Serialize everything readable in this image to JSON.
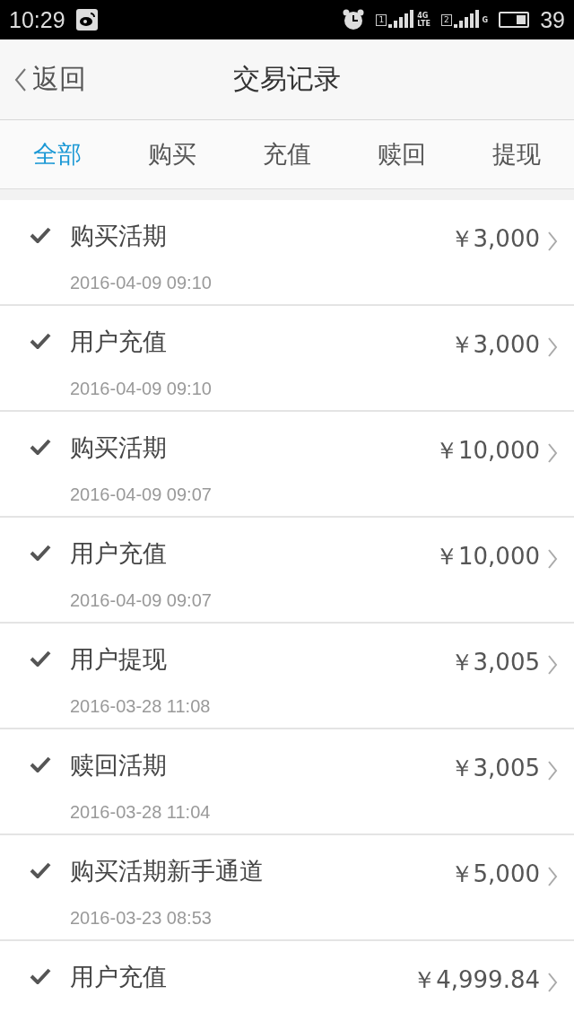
{
  "status_bar": {
    "time": "10:29",
    "sims": [
      {
        "slot": "1",
        "network": "4G",
        "sub": "LTE"
      },
      {
        "slot": "2",
        "network": "G"
      }
    ],
    "battery": "39"
  },
  "header": {
    "back": "返回",
    "title": "交易记录"
  },
  "tabs": [
    {
      "label": "全部",
      "selected": true
    },
    {
      "label": "购买",
      "selected": false
    },
    {
      "label": "充值",
      "selected": false
    },
    {
      "label": "赎回",
      "selected": false
    },
    {
      "label": "提现",
      "selected": false
    }
  ],
  "records": [
    {
      "title": "购买活期",
      "date": "2016-04-09 09:10",
      "amount": "￥3,000",
      "done": true
    },
    {
      "title": "用户充值",
      "date": "2016-04-09 09:10",
      "amount": "￥3,000",
      "done": true
    },
    {
      "title": "购买活期",
      "date": "2016-04-09 09:07",
      "amount": "￥10,000",
      "done": true
    },
    {
      "title": "用户充值",
      "date": "2016-04-09 09:07",
      "amount": "￥10,000",
      "done": true
    },
    {
      "title": "用户提现",
      "date": "2016-03-28 11:08",
      "amount": "￥3,005",
      "done": true
    },
    {
      "title": "赎回活期",
      "date": "2016-03-28 11:04",
      "amount": "￥3,005",
      "done": true
    },
    {
      "title": "购买活期新手通道",
      "date": "2016-03-23 08:53",
      "amount": "￥5,000",
      "done": true
    },
    {
      "title": "用户充值",
      "amount": "￥4,999.84",
      "done": true
    }
  ]
}
